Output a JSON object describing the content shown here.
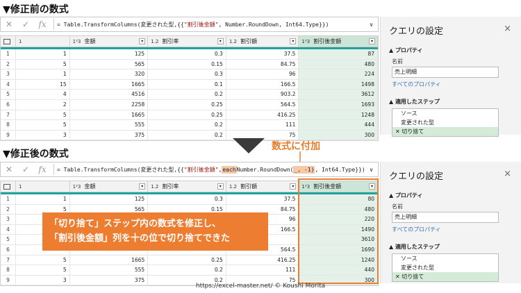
{
  "before": {
    "title": "▼修正前の数式",
    "formula": {
      "prefix": "= Table.TransformColumns(変更された型,{{",
      "str": "\"割引後金額\"",
      "mid": ", Number.RoundDown, Int64.Type}})",
      "each": "",
      "dd": "∨"
    }
  },
  "after": {
    "title": "▼修正後の数式",
    "formula": {
      "prefix": "= Table.TransformColumns(変更された型,{{",
      "str": "\"割引後金額\"",
      "comma": ",",
      "each": "each",
      "mid": " Number.RoundDown(",
      "arg": "_, -1)",
      "end": ", Int64.Type}})",
      "dd": "∨"
    }
  },
  "toolbar": {
    "cancel": "✕",
    "confirm": "✓",
    "fx": "fx"
  },
  "columns": [
    {
      "type": "1²3",
      "name": "金額"
    },
    {
      "type": "1.2",
      "name": "割引率"
    },
    {
      "type": "1.2",
      "name": "割引額"
    },
    {
      "type": "1²3",
      "name": "割引後金額"
    }
  ],
  "first_col_type": "1",
  "rows_before": [
    [
      "1",
      "1",
      "125",
      "0.3",
      "37.5",
      "87"
    ],
    [
      "2",
      "5",
      "565",
      "0.15",
      "84.75",
      "480"
    ],
    [
      "3",
      "1",
      "320",
      "0.3",
      "96",
      "224"
    ],
    [
      "4",
      "15",
      "1665",
      "0.1",
      "166.5",
      "1498"
    ],
    [
      "5",
      "4",
      "4516",
      "0.2",
      "903.2",
      "3612"
    ],
    [
      "6",
      "2",
      "2258",
      "0.25",
      "564.5",
      "1693"
    ],
    [
      "7",
      "5",
      "1665",
      "0.25",
      "416.25",
      "1248"
    ],
    [
      "8",
      "5",
      "555",
      "0.2",
      "111",
      "444"
    ],
    [
      "9",
      "3",
      "375",
      "0.2",
      "75",
      "300"
    ]
  ],
  "rows_after": [
    [
      "1",
      "1",
      "125",
      "0.3",
      "37.5",
      "80"
    ],
    [
      "2",
      "5",
      "565",
      "0.15",
      "84.75",
      "480"
    ],
    [
      "3",
      "",
      "",
      "",
      "96",
      "220"
    ],
    [
      "4",
      "",
      "",
      "",
      "166.5",
      "1490"
    ],
    [
      "5",
      "",
      "",
      "",
      "",
      "3610"
    ],
    [
      "6",
      "",
      "",
      "",
      "564.5",
      "1690"
    ],
    [
      "7",
      "5",
      "1665",
      "0.25",
      "416.25",
      "1240"
    ],
    [
      "8",
      "5",
      "555",
      "0.2",
      "111",
      "440"
    ],
    [
      "9",
      "3",
      "375",
      "0.2",
      "75",
      "300"
    ]
  ],
  "panel": {
    "title": "クエリの設定",
    "close": "×",
    "props_header": "▲ プロパティ",
    "name_label": "名前",
    "name_value": "売上明細",
    "all_props": "すべてのプロパティ",
    "steps_header": "▲ 適用したステップ",
    "steps": [
      "ソース",
      "変更された型",
      "✕ 切り捨て"
    ]
  },
  "annotation": {
    "note": "数式に付加",
    "callout_line1": "「切り捨て」ステップ内の数式を修正し、",
    "callout_line2": "「割引後金額」列を十の位で切り捨てできた"
  },
  "footer": "https://excel-master.net/ © Koushi Morita",
  "colors": {
    "accent": "#ed7d31",
    "teal": "#1fa39d",
    "highlight_col": "#e3f1e8"
  }
}
